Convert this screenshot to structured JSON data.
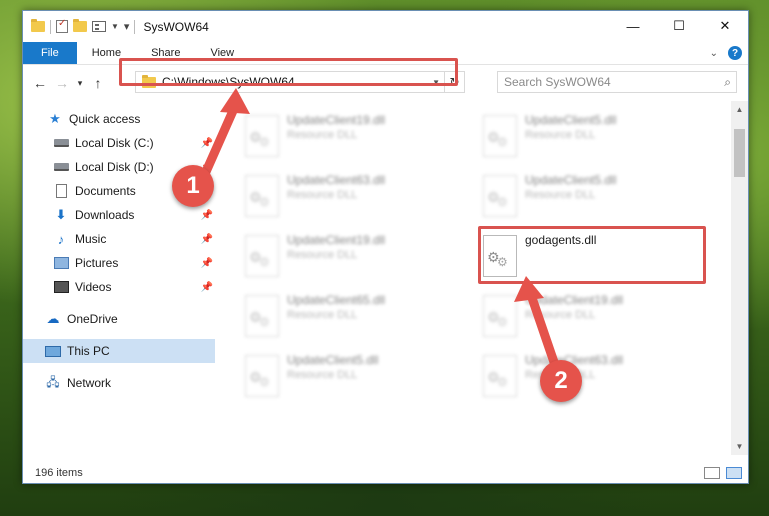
{
  "window": {
    "title": "SysWOW64"
  },
  "window_buttons": {
    "minimize": "—",
    "maximize": "☐",
    "close": "✕"
  },
  "ribbon": {
    "tabs": [
      "File",
      "Home",
      "Share",
      "View"
    ]
  },
  "address": {
    "path": "C:\\Windows\\SysWOW64"
  },
  "search": {
    "placeholder": "Search SysWOW64"
  },
  "sidebar": {
    "items": [
      {
        "label": "Quick access",
        "icon": "star-icon"
      },
      {
        "label": "Local Disk (C:)",
        "icon": "drive-icon",
        "pinned": true
      },
      {
        "label": "Local Disk (D:)",
        "icon": "drive-icon",
        "pinned": true
      },
      {
        "label": "Documents",
        "icon": "document-icon",
        "pinned": true
      },
      {
        "label": "Downloads",
        "icon": "download-icon",
        "pinned": true
      },
      {
        "label": "Music",
        "icon": "music-icon",
        "pinned": true
      },
      {
        "label": "Pictures",
        "icon": "pictures-icon",
        "pinned": true
      },
      {
        "label": "Videos",
        "icon": "video-icon",
        "pinned": true
      },
      {
        "label": "OneDrive",
        "icon": "cloud-icon"
      },
      {
        "label": "This PC",
        "icon": "computer-icon",
        "selected": true
      },
      {
        "label": "Network",
        "icon": "network-icon"
      }
    ]
  },
  "files": [
    {
      "name": "UpdateClient19.dll",
      "desc": "Resource DLL"
    },
    {
      "name": "UpdateClient5.dll",
      "desc": "Resource DLL"
    },
    {
      "name": "UpdateClient63.dll",
      "desc": "Resource DLL"
    },
    {
      "name": "UpdateClient5.dll",
      "desc": "Resource DLL"
    },
    {
      "name": "UpdateClient19.dll",
      "desc": "Resource DLL"
    },
    {
      "name": "godagents.dll",
      "desc": ""
    },
    {
      "name": "UpdateClient65.dll",
      "desc": "Resource DLL"
    },
    {
      "name": "UpdateClient19.dll",
      "desc": "Resource DLL"
    },
    {
      "name": "UpdateClient5.dll",
      "desc": "Resource DLL"
    },
    {
      "name": "UpdateClient63.dll",
      "desc": "Resource DLL"
    }
  ],
  "status": {
    "item_count": "196 items"
  },
  "annotations": {
    "badge1": "1",
    "badge2": "2",
    "color": "#e5534b"
  }
}
